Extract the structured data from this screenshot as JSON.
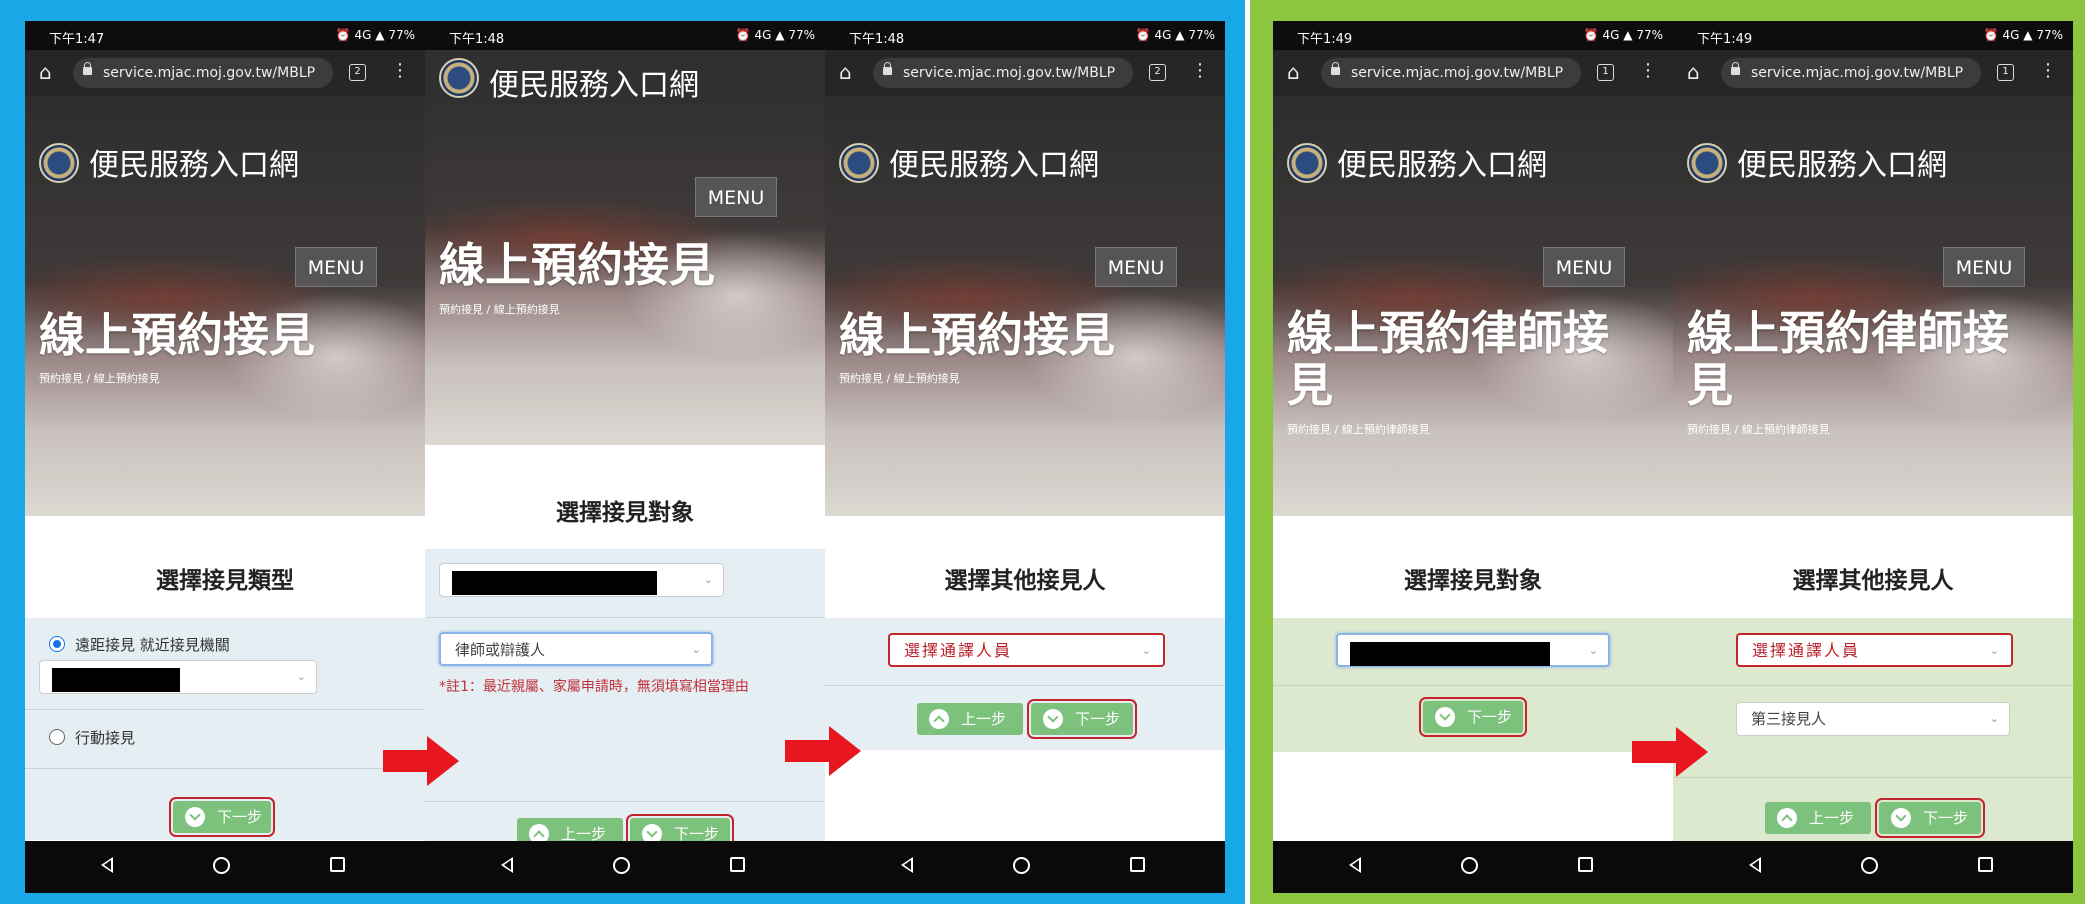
{
  "colors": {
    "blue_frame": "#1aa7e8",
    "green_frame": "#8cc63f",
    "arrow": "#e8161e",
    "highlight_box": "#c4242b",
    "button_green": "#7cc17c"
  },
  "common": {
    "url": "service.mjac.moj.gov.tw/MBLP",
    "site_name": "便民服務入口網",
    "menu": "MENU",
    "battery": "77%",
    "network": "4G",
    "next": "下一步",
    "prev": "上一步"
  },
  "phones": [
    {
      "time": "下午1:47",
      "tab_count": "2",
      "title": "線上預約接見",
      "breadcrumb": "預約接見 / 線上預約接見",
      "section_title": "選擇接見類型",
      "radio_options": [
        {
          "label": "遠距接見 就近接見機關",
          "checked": true
        },
        {
          "label": "行動接見",
          "checked": false
        }
      ]
    },
    {
      "time": "下午1:48",
      "title": "線上預約接見",
      "breadcrumb": "預約接見 / 線上預約接見",
      "section_title": "選擇接見對象",
      "select_role": "律師或辯護人",
      "note": "*註1：最近親屬、家屬申請時，無須填寫相當理由"
    },
    {
      "time": "下午1:48",
      "tab_count": "2",
      "title": "線上預約接見",
      "breadcrumb": "預約接見 / 線上預約接見",
      "section_title": "選擇其他接見人",
      "select_interpreter": "選擇通譯人員"
    },
    {
      "time": "下午1:49",
      "tab_count": "1",
      "title_line1": "線上預約律師接",
      "title_line2": "見",
      "breadcrumb": "預約接見 / 線上預約律師接見",
      "section_title": "選擇接見對象"
    },
    {
      "time": "下午1:49",
      "tab_count": "1",
      "title_line1": "線上預約律師接",
      "title_line2": "見",
      "breadcrumb": "預約接見 / 線上預約律師接見",
      "section_title": "選擇其他接見人",
      "select_interpreter": "選擇通譯人員",
      "select_third": "第三接見人"
    }
  ]
}
